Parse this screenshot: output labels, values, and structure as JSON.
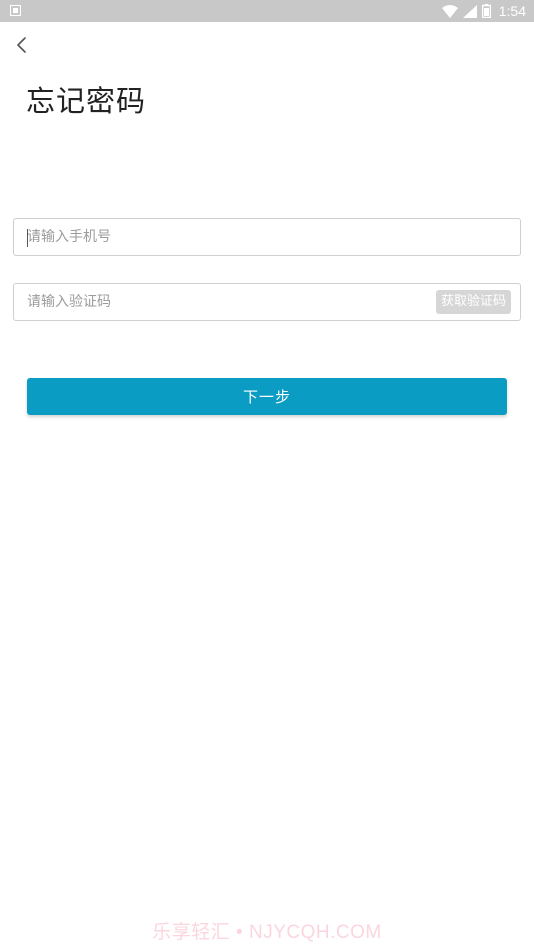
{
  "status_bar": {
    "time": "1:54",
    "icons": [
      "notification-icon",
      "wifi-icon",
      "signal-icon",
      "battery-icon"
    ]
  },
  "header": {
    "back_icon": "chevron-left-icon",
    "title": "忘记密码"
  },
  "form": {
    "phone": {
      "placeholder": "请输入手机号",
      "value": ""
    },
    "code": {
      "placeholder": "请输入验证码",
      "value": "",
      "get_code_label": "获取验证码"
    },
    "next_label": "下一步"
  },
  "watermark": "乐享轻汇 • NJYCQH.COM",
  "colors": {
    "primary": "#0a9cc3",
    "status_bar": "#c8c8c8",
    "disabled_button": "#d6d6d6",
    "watermark": "#fbd6de"
  }
}
